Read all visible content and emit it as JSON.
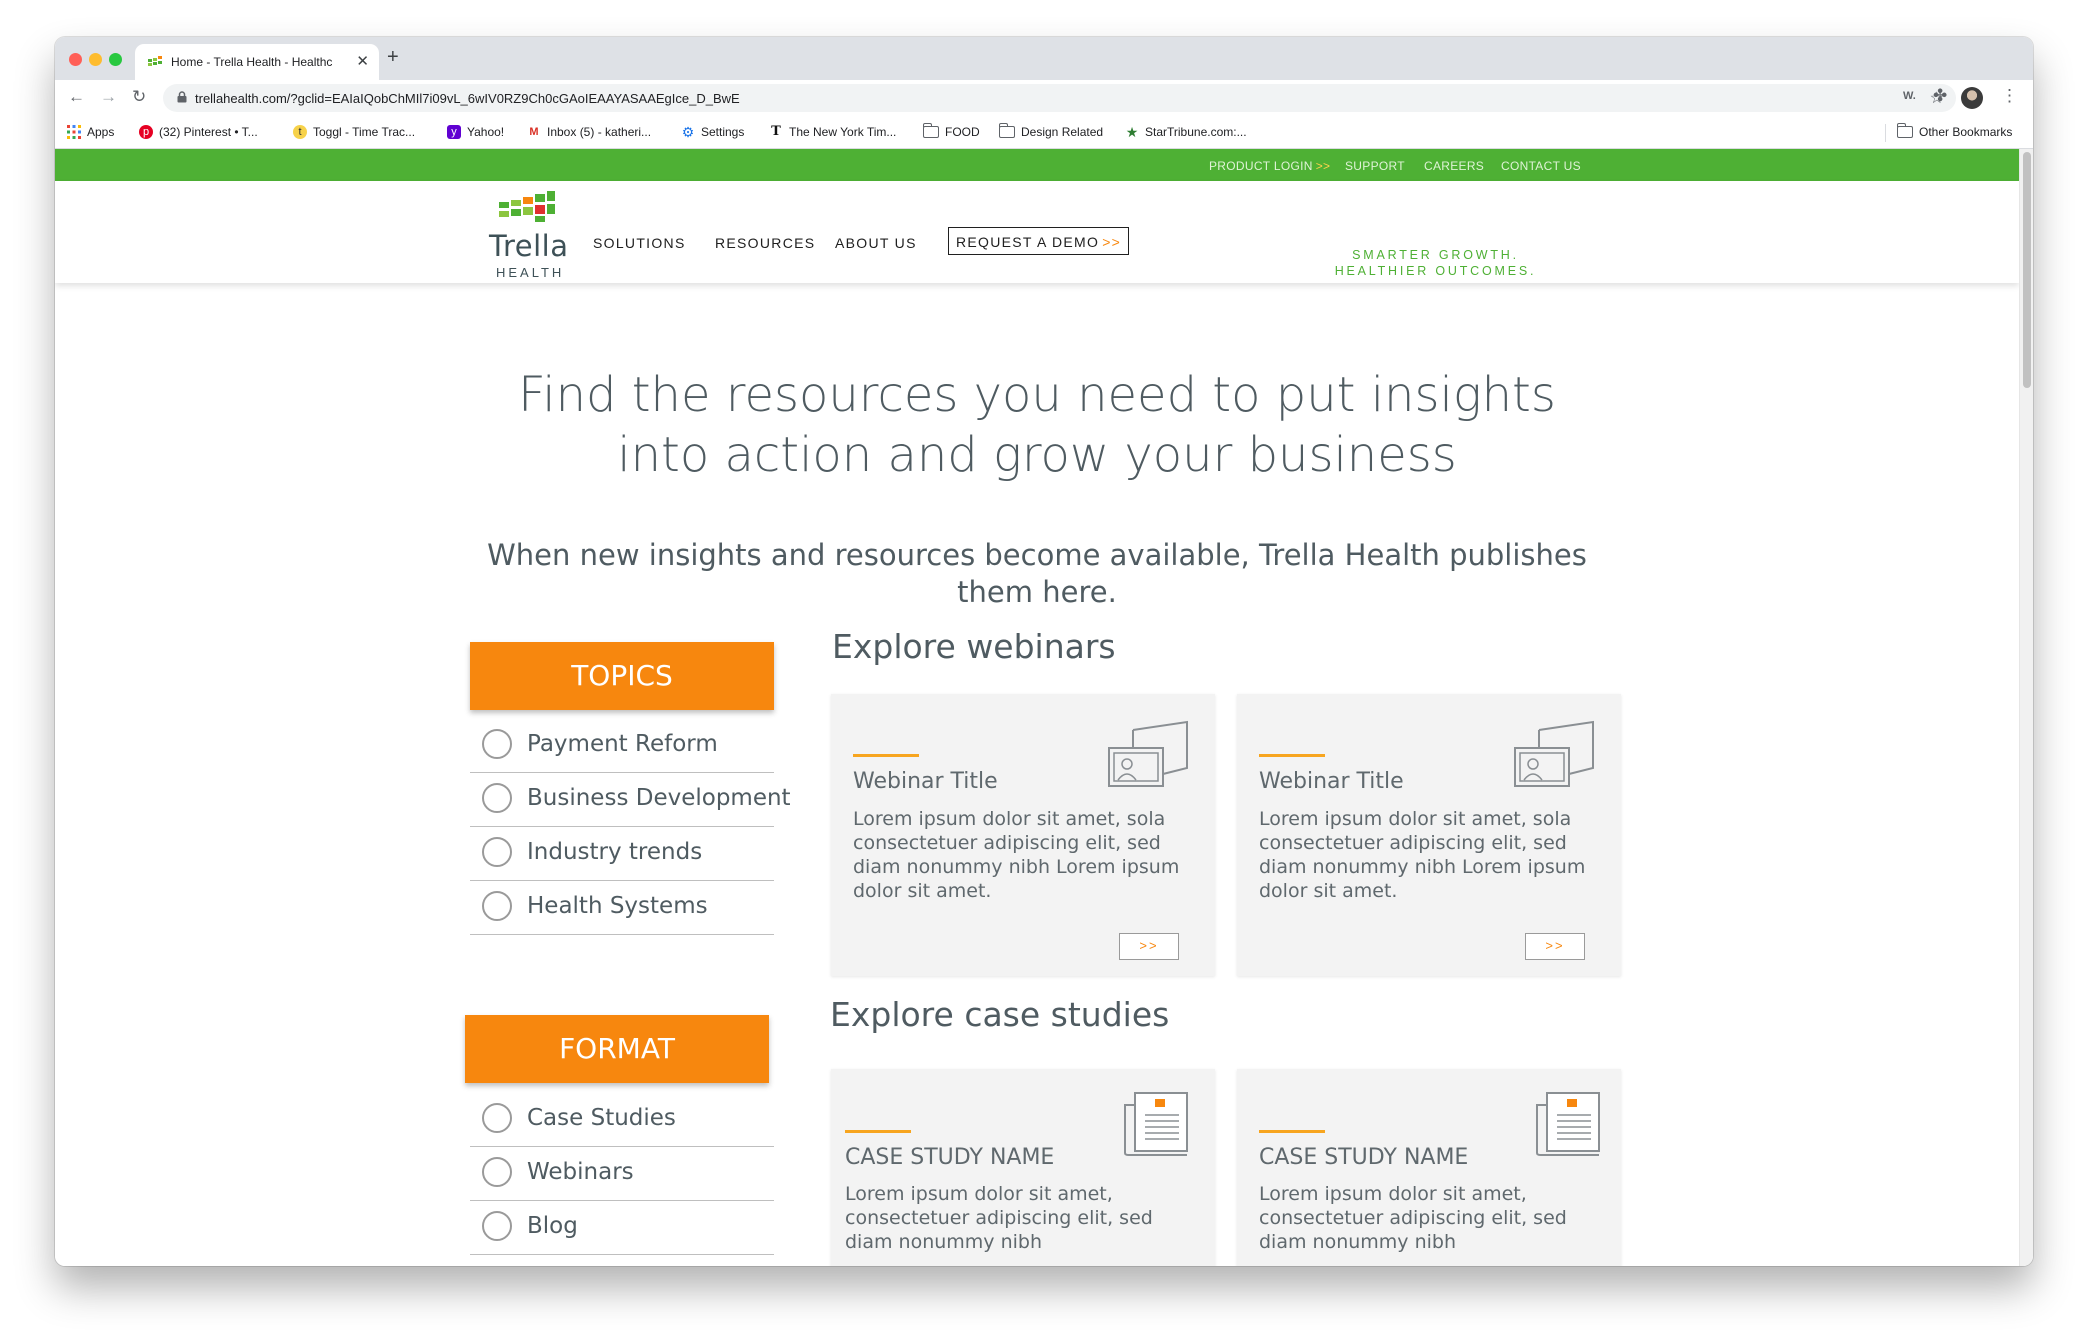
{
  "browser": {
    "tab_title": "Home - Trella Health - Healthc",
    "url": "trellahealth.com/?gclid=EAIaIQobChMIl7i09vL_6wIV0RZ9Ch0cGAoIEAAYASAAEgIce_D_BwE",
    "extension_label": "W.",
    "bookmarks": [
      {
        "label": "Apps",
        "icon": "apps-grid-icon"
      },
      {
        "label": "(32) Pinterest • T...",
        "icon": "pinterest-icon"
      },
      {
        "label": "Toggl - Time Trac...",
        "icon": "toggl-icon"
      },
      {
        "label": "Yahoo!",
        "icon": "yahoo-icon"
      },
      {
        "label": "Inbox (5) - katheri...",
        "icon": "gmail-icon"
      },
      {
        "label": "Settings",
        "icon": "gear-icon"
      },
      {
        "label": "The New York Tim...",
        "icon": "nyt-icon"
      },
      {
        "label": "FOOD",
        "icon": "folder-icon"
      },
      {
        "label": "Design Related",
        "icon": "folder-icon"
      },
      {
        "label": "StarTribune.com:...",
        "icon": "startribune-icon"
      }
    ],
    "other_bookmarks": "Other Bookmarks"
  },
  "utility_nav": {
    "product_login": "PRODUCT LOGIN",
    "login_arrows": ">>",
    "support": "SUPPORT",
    "careers": "CAREERS",
    "contact": "CONTACT US"
  },
  "header": {
    "logo_name": "Trella",
    "logo_sub": "HEALTH",
    "nav": [
      "SOLUTIONS",
      "RESOURCES",
      "ABOUT US"
    ],
    "demo_label": "REQUEST A DEMO",
    "demo_arrows": ">>",
    "tagline_line1": "SMARTER GROWTH.",
    "tagline_line2": "HEALTHIER OUTCOMES."
  },
  "hero": {
    "title": "Find the resources you need to put insights into action and grow your business",
    "subtitle": "When new insights and resources become available, Trella Health publishes them here."
  },
  "filters": {
    "topics_title": "TOPICS",
    "topics": [
      "Payment Reform",
      "Business Development",
      "Industry trends",
      "Health Systems"
    ],
    "format_title": "FORMAT",
    "formats": [
      "Case Studies",
      "Webinars",
      "Blog"
    ]
  },
  "webinars": {
    "section_title": "Explore webinars",
    "cards": [
      {
        "title": "Webinar Title",
        "body": "Lorem ipsum dolor sit amet, sola consectetuer adipiscing elit, sed diam nonummy nibh Lorem ipsum dolor sit amet.",
        "button": ">>"
      },
      {
        "title": "Webinar Title",
        "body": "Lorem ipsum dolor sit amet, sola consectetuer adipiscing elit, sed diam nonummy nibh Lorem ipsum dolor sit amet.",
        "button": ">>"
      }
    ]
  },
  "case_studies": {
    "section_title": "Explore case studies",
    "cards": [
      {
        "title": "CASE STUDY NAME",
        "body": "Lorem ipsum dolor sit amet, consectetuer adipiscing elit, sed diam nonummy nibh"
      },
      {
        "title": "CASE STUDY NAME",
        "body": "Lorem ipsum dolor sit amet, consectetuer adipiscing elit, sed diam nonummy nibh"
      }
    ]
  },
  "colors": {
    "brand_green": "#4eb034",
    "brand_orange": "#f7870e",
    "accent_gold": "#f7a51f",
    "text_gray": "#4f5b61"
  }
}
